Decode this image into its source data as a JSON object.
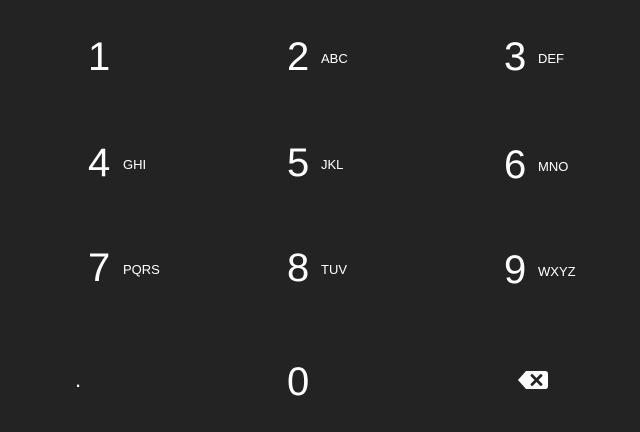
{
  "keypad": {
    "keys": [
      {
        "digit": "1",
        "letters": ""
      },
      {
        "digit": "2",
        "letters": "ABC"
      },
      {
        "digit": "3",
        "letters": "DEF"
      },
      {
        "digit": "4",
        "letters": "GHI"
      },
      {
        "digit": "5",
        "letters": "JKL"
      },
      {
        "digit": "6",
        "letters": "MNO"
      },
      {
        "digit": "7",
        "letters": "PQRS"
      },
      {
        "digit": "8",
        "letters": "TUV"
      },
      {
        "digit": "9",
        "letters": "WXYZ"
      },
      {
        "digit": "0",
        "letters": ""
      }
    ],
    "decimal": ".",
    "backspace_icon": "backspace-icon"
  },
  "colors": {
    "background": "#232323",
    "text": "#ffffff"
  }
}
